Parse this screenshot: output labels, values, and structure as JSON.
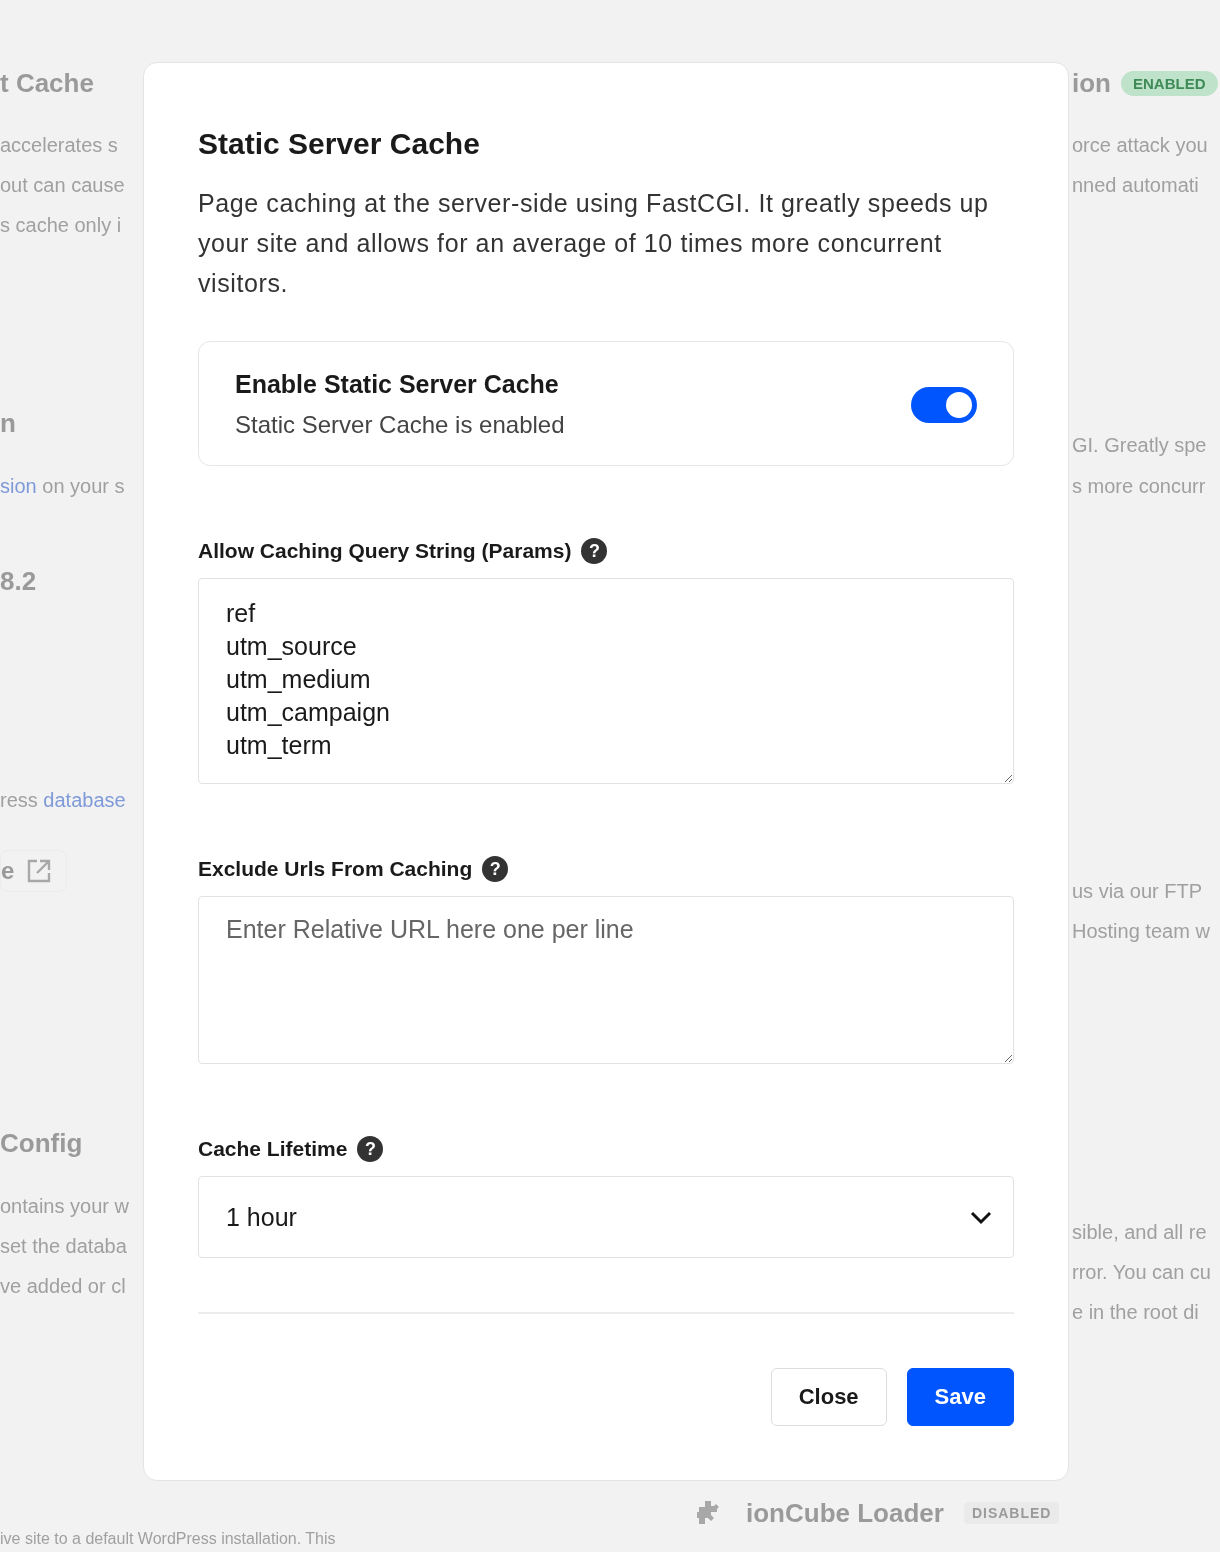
{
  "backdrop": {
    "left": [
      {
        "kind": "heading",
        "parts": [
          {
            "text": "t Cache",
            "link": false
          }
        ]
      },
      {
        "kind": "text",
        "parts": [
          {
            "text": "accelerates s",
            "link": false
          }
        ]
      },
      {
        "kind": "text",
        "parts": [
          {
            "text": "out can cause",
            "link": false
          }
        ]
      },
      {
        "kind": "text",
        "parts": [
          {
            "text": "s cache only i",
            "link": false
          }
        ]
      },
      {
        "kind": "heading",
        "parts": [
          {
            "text": "n",
            "link": false
          }
        ]
      },
      {
        "kind": "text",
        "parts": [
          {
            "text": "sion",
            "link": true
          },
          {
            "text": " on your s",
            "link": false
          }
        ]
      },
      {
        "kind": "heading",
        "parts": [
          {
            "text": "8.2",
            "link": false
          }
        ]
      },
      {
        "kind": "text",
        "parts": [
          {
            "text": "ress ",
            "link": false
          },
          {
            "text": "database",
            "link": true
          }
        ]
      },
      {
        "kind": "button",
        "parts": [
          {
            "text": "e",
            "link": false
          }
        ]
      },
      {
        "kind": "heading",
        "parts": [
          {
            "text": "Config",
            "link": false
          }
        ]
      },
      {
        "kind": "text",
        "parts": [
          {
            "text": "ontains your w",
            "link": false
          }
        ]
      },
      {
        "kind": "text",
        "parts": [
          {
            "text": "set the databa",
            "link": false
          }
        ]
      },
      {
        "kind": "text",
        "parts": [
          {
            "text": "ve added or cl",
            "link": false
          }
        ]
      }
    ],
    "right": [
      {
        "kind": "heading",
        "parts": [
          {
            "text": "ion",
            "link": false
          }
        ],
        "badge": "ENABLED"
      },
      {
        "kind": "text",
        "parts": [
          {
            "text": "orce attack you",
            "link": false
          }
        ]
      },
      {
        "kind": "text",
        "parts": [
          {
            "text": "nned automati",
            "link": false
          }
        ]
      },
      {
        "kind": "text",
        "parts": [
          {
            "text": "GI. Greatly spe",
            "link": false
          }
        ]
      },
      {
        "kind": "text",
        "parts": [
          {
            "text": "s more concurr",
            "link": false
          }
        ]
      },
      {
        "kind": "text",
        "parts": [
          {
            "text": "us via our FTP",
            "link": false
          }
        ]
      },
      {
        "kind": "text",
        "parts": [
          {
            "text": "Hosting team w",
            "link": false
          }
        ]
      },
      {
        "kind": "text",
        "parts": [
          {
            "text": "sible, and all re",
            "link": false
          }
        ]
      },
      {
        "kind": "text",
        "parts": [
          {
            "text": "rror. You can cu",
            "link": false
          }
        ]
      },
      {
        "kind": "text",
        "parts": [
          {
            "text": "e in the root di",
            "link": false
          }
        ]
      }
    ],
    "bottom": {
      "title": "ionCube Loader",
      "badge": "DISABLED",
      "text": "ive site to a default WordPress installation. This"
    }
  },
  "modal": {
    "title": "Static Server Cache",
    "description": "Page caching at the server-side using FastCGI. It greatly speeds up your site and allows for an average of 10 times more concurrent visitors.",
    "toggle": {
      "title": "Enable Static Server Cache",
      "status": "Static Server Cache is enabled",
      "on": true
    },
    "fields": [
      {
        "kind": "textarea",
        "label": "Allow Caching Query String (Params)",
        "help": "?",
        "value": "ref\nutm_source\nutm_medium\nutm_campaign\nutm_term"
      },
      {
        "kind": "textarea",
        "label": "Exclude Urls From Caching",
        "help": "?",
        "placeholder": "Enter Relative URL here one per line"
      },
      {
        "kind": "select",
        "label": "Cache Lifetime",
        "help": "?",
        "value": "1 hour"
      }
    ],
    "buttons": [
      {
        "label": "Close",
        "kind": "secondary"
      },
      {
        "label": "Save",
        "kind": "primary"
      }
    ]
  }
}
